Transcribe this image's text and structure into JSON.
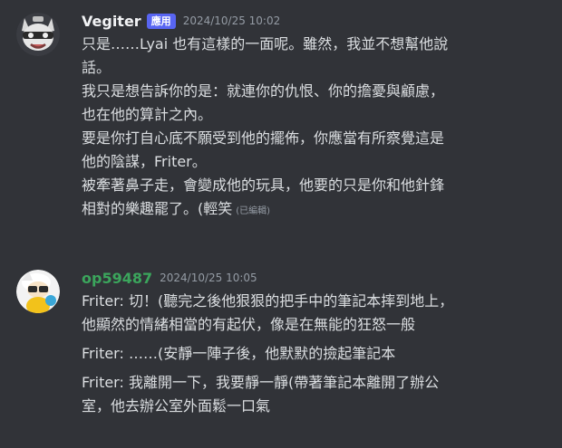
{
  "messages": [
    {
      "username": "Vegiter",
      "username_color": "#f2f3f5",
      "badge": "應用",
      "timestamp": "2024/10/25 10:02",
      "lines": [
        "只是……Lyai 也有這樣的一面呢。雖然，我並不想幫他說",
        "話。",
        "我只是想告訴你的是：就連你的仇恨、你的擔憂與顧慮，",
        "也在他的算計之內。",
        "要是你打自心底不願受到他的擺佈，你應當有所察覺這是",
        "他的陰謀，Friter。",
        "被牽著鼻子走，會變成他的玩具，他要的只是你和他針鋒",
        "相對的樂趣罷了。(輕笑"
      ],
      "edited_label": "(已編輯)"
    },
    {
      "username": "op59487",
      "username_color": "#3ba55c",
      "timestamp": "2024/10/25 10:05",
      "paragraphs": [
        [
          "Friter: 切！(聽完之後他狠狠的把手中的筆記本摔到地上，",
          "他顯然的情緒相當的有起伏，像是在無能的狂怒一般"
        ],
        [
          "Friter: ……(安靜一陣子後，他默默的撿起筆記本"
        ],
        [
          "Friter: 我離開一下，我要靜一靜(帶著筆記本離開了辦公",
          "室，他去辦公室外面鬆一口氣"
        ]
      ]
    }
  ]
}
